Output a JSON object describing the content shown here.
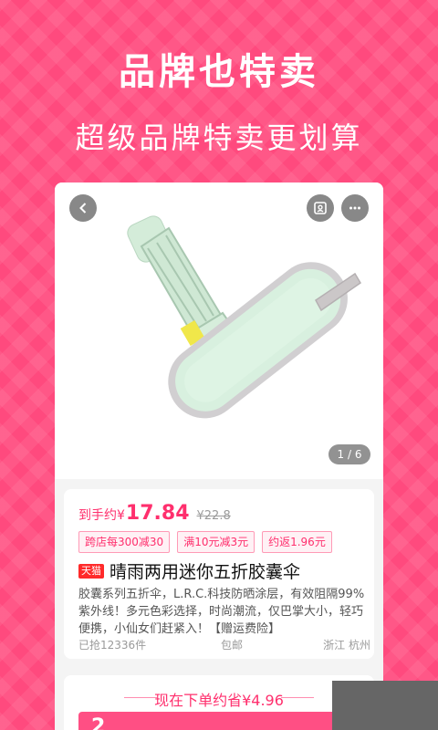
{
  "promo": {
    "headline": "品牌也特卖",
    "subheadline": "超级品牌特卖更划算"
  },
  "nav": {
    "back_icon": "chevron-left-icon",
    "share_icon": "share-code-icon",
    "more_icon": "more-horizontal-icon"
  },
  "gallery": {
    "pager": "1 / 6"
  },
  "product": {
    "price_label": "到手约¥",
    "price": "17.84",
    "original_price": "¥22.8",
    "coupons": [
      "跨店每300减30",
      "满10元减3元",
      "约返1.96元"
    ],
    "badge": "天猫",
    "title": "晴雨两用迷你五折胶囊伞",
    "description": "胶囊系列五折伞，L.R.C.科技防晒涂层，有效阻隔99%紫外线！多元色彩选择，时尚潮流，仅巴掌大小，轻巧便携，小仙女们赶紧入！【赠运费险】",
    "sold": "已抢12336件",
    "shipping": "包邮",
    "location": "浙江 杭州"
  },
  "deal": {
    "label": "现在下单约省¥4.96",
    "bar_digit": "2"
  },
  "colors": {
    "brand": "#ff4a7e",
    "price": "#ff2f6d",
    "umbrella": "#cfe8d4",
    "case": "#d8f0df"
  }
}
